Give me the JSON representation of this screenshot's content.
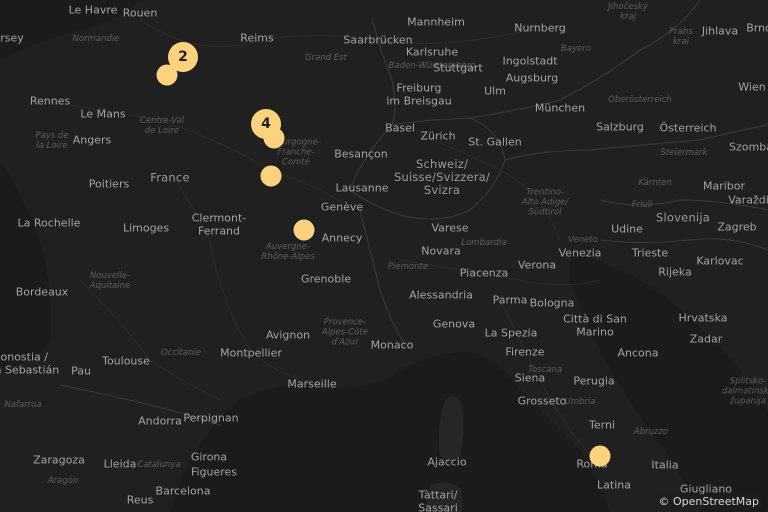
{
  "labels": {
    "major": [
      {
        "id": "le-havre",
        "text": "Le Havre"
      },
      {
        "id": "rouen",
        "text": "Rouen"
      },
      {
        "id": "reims",
        "text": "Reims"
      },
      {
        "id": "saarbrucken",
        "text": "Saarbrücken"
      },
      {
        "id": "mannheim",
        "text": "Mannheim"
      },
      {
        "id": "nurnberg",
        "text": "Nurnberg"
      },
      {
        "id": "karlsruhe",
        "text": "Karlsruhe"
      },
      {
        "id": "ingolstadt",
        "text": "Ingolstadt"
      },
      {
        "id": "stuttgart",
        "text": "Stuttgart"
      },
      {
        "id": "augsburg",
        "text": "Augsburg"
      },
      {
        "id": "rennes",
        "text": "Rennes"
      },
      {
        "id": "le-mans",
        "text": "Le Mans"
      },
      {
        "id": "freiburg",
        "text": "Freiburg\nim Breisgau"
      },
      {
        "id": "ulm",
        "text": "Ulm"
      },
      {
        "id": "munchen",
        "text": "München"
      },
      {
        "id": "wien",
        "text": "Wien"
      },
      {
        "id": "angers",
        "text": "Angers"
      },
      {
        "id": "basel",
        "text": "Basel"
      },
      {
        "id": "zurich",
        "text": "Zürich"
      },
      {
        "id": "st-gallen",
        "text": "St. Gallen"
      },
      {
        "id": "salzburg",
        "text": "Salzburg"
      },
      {
        "id": "osterreich",
        "text": "Österreich"
      },
      {
        "id": "besancon",
        "text": "Besançon"
      },
      {
        "id": "poitiers",
        "text": "Poitiers"
      },
      {
        "id": "lausanne",
        "text": "Lausanne"
      },
      {
        "id": "maribor",
        "text": "Maribor"
      },
      {
        "id": "geneve",
        "text": "Genève"
      },
      {
        "id": "la-rochelle",
        "text": "La Rochelle"
      },
      {
        "id": "clermont",
        "text": "Clermont-\nFerrand"
      },
      {
        "id": "limoges",
        "text": "Limoges"
      },
      {
        "id": "annecy",
        "text": "Annecy"
      },
      {
        "id": "varese",
        "text": "Varese"
      },
      {
        "id": "udine",
        "text": "Udine"
      },
      {
        "id": "zagreb",
        "text": "Zagreb"
      },
      {
        "id": "novara",
        "text": "Novara"
      },
      {
        "id": "venezia",
        "text": "Venezia"
      },
      {
        "id": "trieste",
        "text": "Trieste"
      },
      {
        "id": "verona",
        "text": "Verona"
      },
      {
        "id": "rijeka",
        "text": "Rijeka"
      },
      {
        "id": "karlovac",
        "text": "Karlovac"
      },
      {
        "id": "grenoble",
        "text": "Grenoble"
      },
      {
        "id": "piacenza",
        "text": "Piacenza"
      },
      {
        "id": "bordeaux",
        "text": "Bordeaux"
      },
      {
        "id": "alessandria",
        "text": "Alessandria"
      },
      {
        "id": "parma",
        "text": "Parma"
      },
      {
        "id": "bologna",
        "text": "Bologna"
      },
      {
        "id": "genova",
        "text": "Genova"
      },
      {
        "id": "la-spezia",
        "text": "La Spezia"
      },
      {
        "id": "hrvatska",
        "text": "Hrvatska"
      },
      {
        "id": "citta-san-marino",
        "text": "Città di San\nMarino"
      },
      {
        "id": "avignon",
        "text": "Avignon"
      },
      {
        "id": "monaco",
        "text": "Monaco"
      },
      {
        "id": "zadar",
        "text": "Zadar"
      },
      {
        "id": "firenze",
        "text": "Firenze"
      },
      {
        "id": "toulouse",
        "text": "Toulouse"
      },
      {
        "id": "montpellier",
        "text": "Montpellier"
      },
      {
        "id": "ancona",
        "text": "Ancona"
      },
      {
        "id": "donostia",
        "text": "Donostia /\nSan Sebastián"
      },
      {
        "id": "pau",
        "text": "Pau"
      },
      {
        "id": "perugia",
        "text": "Perugia"
      },
      {
        "id": "marseille",
        "text": "Marseille"
      },
      {
        "id": "siena",
        "text": "Siena"
      },
      {
        "id": "grosseto",
        "text": "Grosseto"
      },
      {
        "id": "perpignan",
        "text": "Perpignan"
      },
      {
        "id": "andorra",
        "text": "Andorra"
      },
      {
        "id": "terni",
        "text": "Terni"
      },
      {
        "id": "girona",
        "text": "Girona"
      },
      {
        "id": "zaragoza",
        "text": "Zaragoza"
      },
      {
        "id": "lleida",
        "text": "Lleida"
      },
      {
        "id": "figueres",
        "text": "Figueres"
      },
      {
        "id": "ajaccio",
        "text": "Ajaccio"
      },
      {
        "id": "italia",
        "text": "Italia"
      },
      {
        "id": "roma",
        "text": "Roma"
      },
      {
        "id": "latina",
        "text": "Latina"
      },
      {
        "id": "giugliano",
        "text": "Giugliano"
      },
      {
        "id": "barcelona",
        "text": "Barcelona"
      },
      {
        "id": "reus",
        "text": "Reus"
      },
      {
        "id": "brno",
        "text": "Brno"
      },
      {
        "id": "jihlava",
        "text": "Jihlava"
      },
      {
        "id": "szomba",
        "text": "Szomba"
      },
      {
        "id": "varazdin",
        "text": "Varaždin"
      },
      {
        "id": "jersey",
        "text": "rsey"
      },
      {
        "id": "tattari",
        "text": "Tàttari/\nSassari"
      }
    ],
    "countries": [
      {
        "id": "france",
        "text": "France"
      },
      {
        "id": "schweiz",
        "text": "Schweiz/\nSuisse/Svizzera/\nSvizra"
      },
      {
        "id": "slovenija",
        "text": "Slovenija"
      }
    ],
    "regions": [
      {
        "id": "normandie",
        "text": "Normandie"
      },
      {
        "id": "grand-est",
        "text": "Grand Est"
      },
      {
        "id": "bayern",
        "text": "Bayern"
      },
      {
        "id": "bw",
        "text": "Baden-Württemberg"
      },
      {
        "id": "centre",
        "text": "Centre-Val\nde Loire"
      },
      {
        "id": "pays-loire",
        "text": "Pays de\nla Loire"
      },
      {
        "id": "bourgogne",
        "text": "Bourgogne-\nFranche-\nComté"
      },
      {
        "id": "oberosterreich",
        "text": "Oberösterreich"
      },
      {
        "id": "steiermark",
        "text": "Steiermark"
      },
      {
        "id": "karnten",
        "text": "Kärnten"
      },
      {
        "id": "trentino",
        "text": "Trentino-\nAlto Adige/\nSüdtirol"
      },
      {
        "id": "lombardia",
        "text": "Lombardia"
      },
      {
        "id": "veneto",
        "text": "Veneto"
      },
      {
        "id": "friuli",
        "text": "Friuli"
      },
      {
        "id": "auvergne",
        "text": "Auvergne-\nRhône-Alpes"
      },
      {
        "id": "piemonte",
        "text": "Piemonte"
      },
      {
        "id": "nouvelle-aquitaine",
        "text": "Nouvelle-\nAquitaine"
      },
      {
        "id": "paca",
        "text": "Provence-\nAlpes-Côte\nd'Azur"
      },
      {
        "id": "occitanie",
        "text": "Occitanie"
      },
      {
        "id": "toscana",
        "text": "Toscana"
      },
      {
        "id": "umbria",
        "text": "Umbria"
      },
      {
        "id": "abruzzo",
        "text": "Abruzzo"
      },
      {
        "id": "catalunya",
        "text": "Catalunya"
      },
      {
        "id": "aragon",
        "text": "Aragón"
      },
      {
        "id": "nafarroa",
        "text": "Nafarroa"
      },
      {
        "id": "jihocesky",
        "text": "Jihočeský\nkraj"
      },
      {
        "id": "praha",
        "text": "Prahs\nkrai"
      },
      {
        "id": "spitsko",
        "text": "Splitsko-\ndalmatinska\nžupanija"
      }
    ]
  },
  "markers": [
    {
      "id": "m1",
      "count": "2",
      "size": "large"
    },
    {
      "id": "m2",
      "count": "",
      "size": "small"
    },
    {
      "id": "m3",
      "count": "4",
      "size": "large"
    },
    {
      "id": "m4",
      "count": "",
      "size": "small"
    },
    {
      "id": "m5",
      "count": "",
      "size": "small"
    },
    {
      "id": "m6",
      "count": "",
      "size": "small"
    },
    {
      "id": "m7",
      "count": "",
      "size": "small"
    }
  ],
  "attribution": "© OpenStreetMap",
  "colors": {
    "land": "#262626",
    "sea": "#1d1d1d",
    "marker": "#fdd27e",
    "borders": "#3a3a3a"
  }
}
